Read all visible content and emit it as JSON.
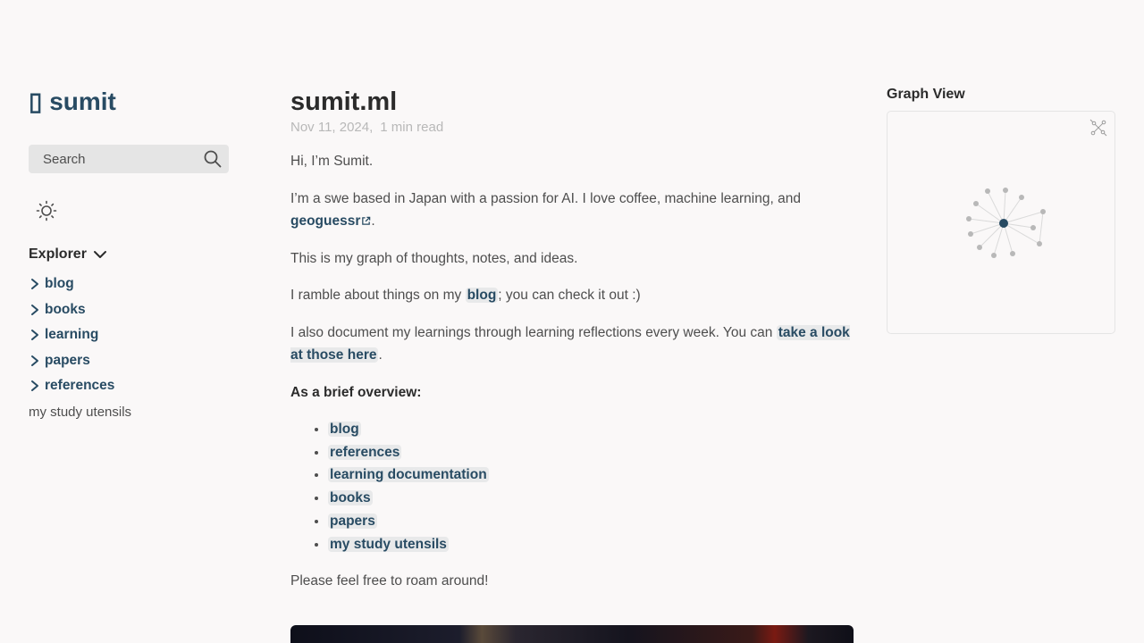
{
  "site": {
    "title_glyph": "▯",
    "title": "sumit"
  },
  "search": {
    "placeholder": "Search",
    "icon": "search-icon"
  },
  "darkmode": {
    "icon": "sun-icon"
  },
  "explorer": {
    "label": "Explorer",
    "folders": [
      "blog",
      "books",
      "learning",
      "papers",
      "references"
    ],
    "file": "my study utensils"
  },
  "article": {
    "title": "sumit.ml",
    "date": "Nov 11, 2024,",
    "read_time": "1 min read",
    "p1": "Hi, I’m Sumit.",
    "p2_before": "I’m a swe based in Japan with a passion for AI. I love coffee, machine learning, and ",
    "p2_link": "geoguessr",
    "p2_after": ".",
    "p3": "This is my graph of thoughts, notes, and ideas.",
    "p4_before": "I ramble about things on my ",
    "p4_link": "blog",
    "p4_after": "; you can check it out :)",
    "p5_before": "I also document my learnings through learning reflections every week. You can ",
    "p5_link": "take a look at those here",
    "p5_after": ".",
    "overview_heading": "As a brief overview:",
    "overview_items": [
      "blog",
      "references",
      "learning documentation",
      "books",
      "papers",
      "my study utensils"
    ],
    "p7": "Please feel free to roam around!"
  },
  "graph": {
    "title": "Graph View",
    "expand_icon": "graph-expand-icon",
    "center_color": "#284b63",
    "node_color": "#b8b8b8",
    "link_color": "#dadada"
  }
}
